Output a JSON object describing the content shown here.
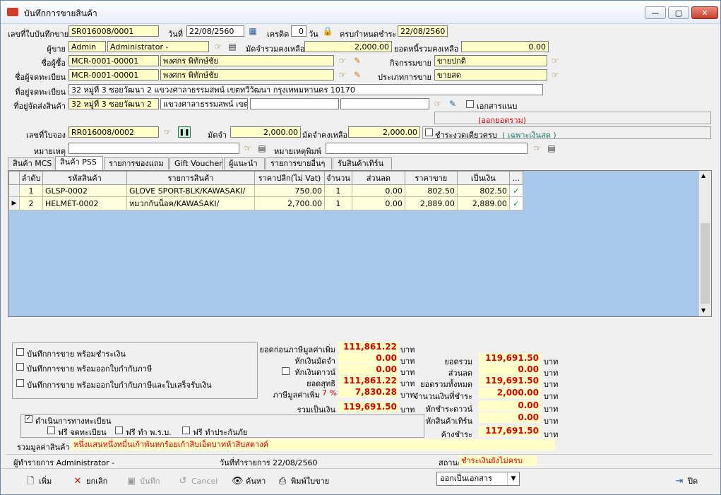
{
  "window": {
    "title": "บันทึกการขายสินค้า",
    "min": "—",
    "max": "▢",
    "close": "✕"
  },
  "header": {
    "invoice_label": "เลขที่ใบบันทึกขาย",
    "invoice_value": "SR016008/0001",
    "date_label": "วันที่",
    "date_value": "22/08/2560",
    "credit_label": "เครดิต",
    "credit_value": "0",
    "credit_unit": "วัน",
    "due_label": "ครบกำหนดชำระ",
    "due_value": "22/08/2560",
    "seller_label": "ผู้ขาย",
    "seller_code": "Admin",
    "seller_name": "Administrator -",
    "deposit_remain_label": "มัดจำรวมคงเหลือ",
    "deposit_remain_value": "2,000.00",
    "debt_remain_label": "ยอดหนี้รวมคงเหลือ",
    "debt_remain_value": "0.00",
    "buyer_label": "ชื่อผู้ซื้อ",
    "buyer_code": "MCR-0001-00001",
    "buyer_name": "พงศกร พิทักษ์ชัย",
    "activity_label": "กิจกรรมขาย",
    "activity_value": "ขายปกติ",
    "registrant_label": "ชื่อผู้จดทะเบียน",
    "registrant_code": "MCR-0001-00001",
    "registrant_name": "พงศกร พิทักษ์ชัย",
    "sale_type_label": "ประเภทการขาย",
    "sale_type_value": "ขายสด",
    "reg_address_label": "ที่อยู่จดทะเบียน",
    "reg_address_value": "32 หมู่ที่ 3 ซอยวัฒนา 2 แขวงศาลาธรรมสพน์ เขตทวีวัฒนา กรุงเทพมหานคร 10170",
    "ship_address_label": "ที่อยู่จัดส่งสินค้า",
    "ship_address_1": "32 หมู่ที่ 3 ซอยวัฒนา 2",
    "ship_address_2": "แขวงศาลาธรรมสพน์ เขต",
    "attach_label": "เอกสารแนบ",
    "cancel_all_text": "(ออกยอดรวม)",
    "booking_label": "เลขที่ใบจอง",
    "booking_value": "RR016008/0002",
    "deposit_label": "มัดจำ",
    "deposit_value": "2,000.00",
    "deposit_rest_label": "มัดจำคงเหลือ",
    "deposit_rest_value": "2,000.00",
    "pay_once_label": "ชำระงวดเดียวครบ",
    "cash_only_text": "( เฉพาะเงินสด )",
    "note_label": "หมายเหตุ",
    "print_note_label": "หมายเหตุพิมพ์"
  },
  "tabs": [
    {
      "label": "สินค้า MCS"
    },
    {
      "label": "สินค้า PSS"
    },
    {
      "label": "รายการของแถม"
    },
    {
      "label": "Gift Voucher"
    },
    {
      "label": "ผู้แนะนำ"
    },
    {
      "label": "รายการขายอื่นๆ"
    },
    {
      "label": "รับสินค้าเทิร์น"
    }
  ],
  "grid": {
    "columns": [
      "ลำดับ",
      "รหัสสินค้า",
      "รายการสินค้า",
      "ราคาปลีก(ไม่ Vat)",
      "จำนวน",
      "ส่วนลด",
      "ราคาขาย",
      "เป็นเงิน",
      "..."
    ],
    "rows": [
      {
        "no": "1",
        "code": "GLSP-0002",
        "name": "GLOVE SPORT-BLK/KAWASAKI/",
        "price": "750.00",
        "qty": "1",
        "disc": "0.00",
        "sale": "802.50",
        "amount": "802.50",
        "check": "✓"
      },
      {
        "no": "2",
        "code": "HELMET-0002",
        "name": "หมวกกันน็อค/KAWASAKI/",
        "price": "2,700.00",
        "qty": "1",
        "disc": "0.00",
        "sale": "2,889.00",
        "amount": "2,889.00",
        "check": "✓"
      }
    ]
  },
  "options": {
    "opt1": "บันทึกการขาย พร้อมชำระเงิน",
    "opt2": "บันทึกการขาย พร้อมออกใบกำกับภาษี",
    "opt3": "บันทึกการขาย พร้อมออกใบกำกับภาษีและใบเสร็จรับเงิน",
    "register_label": "ดำเนินการทางทะเบียน",
    "free_reg": "ฟรี จดทะเบียน",
    "free_prb": "ฟรี ทำ พ.ร.บ.",
    "free_ins": "ฟรี ทำประกันภัย",
    "total_text_label": "รวมมูลค่าสินค้า",
    "total_text_value": "หนึ่งแสนหนึ่งหมื่นเก้าพันหกร้อยเก้าสิบเอ็ดบาทห้าสิบสตางค์"
  },
  "summary_mid": {
    "pre_vat_label": "ยอดก่อนภาษีมูลค่าเพิ่ม",
    "pre_vat_value": "111,861.22",
    "deduct_deposit_label": "หักเงินมัดจำ",
    "deduct_deposit_value": "0.00",
    "deduct_down_label": "หักเงินดาวน์",
    "deduct_down_value": "0.00",
    "net_label": "ยอดสุทธิ",
    "net_value": "111,861.22",
    "vat_label": "ภาษีมูลค่าเพิ่ม",
    "vat_rate": "7 %",
    "vat_value": "7,830.28",
    "grand_label": "รวมเป็นเงิน",
    "grand_value": "119,691.50",
    "unit": "บาท"
  },
  "summary_right": {
    "total_label": "ยอดรวม",
    "total_value": "119,691.50",
    "discount_label": "ส่วนลด",
    "discount_value": "0.00",
    "all_total_label": "ยอดรวมทั้งหมด",
    "all_total_value": "119,691.50",
    "paid_label": "จำนวนเงินที่ชำระ",
    "paid_value": "2,000.00",
    "down_label": "หักชำระดาวน์",
    "down_value": "0.00",
    "turn_label": "หักสินค้าเทิร์น",
    "turn_value": "0.00",
    "owe_label": "ค้างชำระ",
    "owe_value": "117,691.50",
    "unit": "บาท"
  },
  "status": {
    "maker": "ผู้ทำรายการ Administrator -",
    "made_date": "วันที่ทำรายการ 22/08/2560",
    "state_label": "สถานะ",
    "state_value": "ชำระเงินยังไม่ครบ"
  },
  "toolbar": {
    "add": "เพิ่ม",
    "cancel_doc": "ยกเลิก",
    "save": "บันทึก",
    "cancel": "Cancel",
    "search": "ค้นหา",
    "print": "พิมพ์ใบขาย",
    "output_select": "ออกเป็นเอกสาร",
    "close": "ปิด"
  }
}
